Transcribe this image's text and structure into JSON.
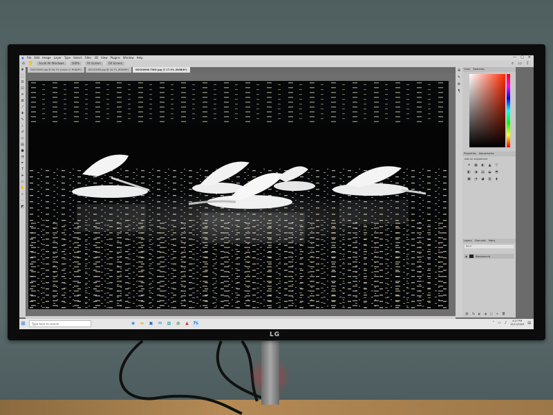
{
  "app": {
    "menu": [
      "File",
      "Edit",
      "Image",
      "Layer",
      "Type",
      "Select",
      "Filter",
      "3D",
      "View",
      "Plugins",
      "Window",
      "Help"
    ],
    "window_controls": [
      "—",
      "▢",
      "✕"
    ]
  },
  "options_bar": {
    "buttons": [
      "Scroll All Windows",
      "100%",
      "Fit Screen",
      "Fill Screen"
    ],
    "icons": [
      "search-icon",
      "workspace-icon",
      "share-icon"
    ]
  },
  "tabs": [
    {
      "label": "DSC00000.jpg @ 16.7% (Layer 0, RGB/8*)",
      "active": false
    },
    {
      "label": "DSC00000.jpg @ 16.7% (RGB/8*)",
      "active": false
    },
    {
      "label": "DSC00000 TWO.jpg @ 17.9% (RGB/8*)",
      "active": true
    }
  ],
  "tools": [
    "move",
    "marquee",
    "lasso",
    "select",
    "crop",
    "frame",
    "eyedropper",
    "heal",
    "brush",
    "stamp",
    "history",
    "eraser",
    "gradient",
    "blur",
    "dodge",
    "pen",
    "type",
    "path",
    "shape",
    "hand",
    "zoom",
    "more"
  ],
  "panels": {
    "color_tabs": [
      "Color",
      "Swatches"
    ],
    "properties_tabs": [
      "Properties",
      "Adjustments"
    ],
    "properties_sub": "Add an adjustment",
    "adjustments": [
      "☀",
      "▦",
      "◐",
      "▲",
      "▽",
      "◧",
      "◑",
      "▤",
      "◒",
      "◓",
      "▣",
      "◔",
      "◕",
      "▥",
      "◖"
    ],
    "layers_tabs": [
      "Layers",
      "Channels",
      "Paths"
    ],
    "layer_search": "Kind",
    "layer_name": "Background",
    "layer_footer": [
      "⛓",
      "fx",
      "◐",
      "◑",
      "▢",
      "+",
      "🗑"
    ]
  },
  "status": "17.9%",
  "taskbar": {
    "search_placeholder": "Type here to search",
    "apps": [
      "edge",
      "files",
      "store",
      "mail",
      "photos",
      "chrome",
      "acrobat",
      "photoshop"
    ],
    "time": "4:27 PM",
    "date": "12/11/2020"
  },
  "monitor_brand": "LG",
  "colors": {
    "accent": "#1d6fd6",
    "screen_bg": "#6b6b6b"
  }
}
